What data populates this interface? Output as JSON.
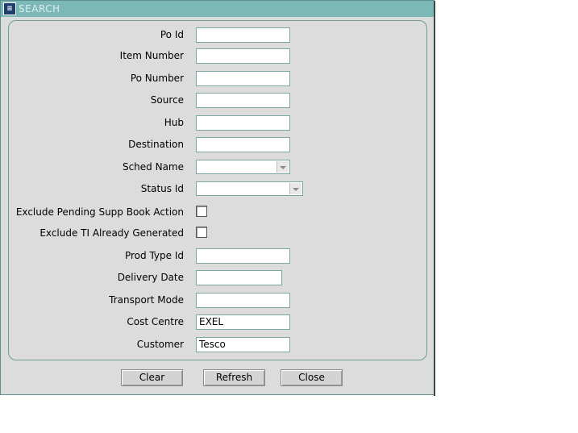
{
  "window": {
    "title": "SEARCH"
  },
  "fields": [
    {
      "label": "Po Id",
      "value": ""
    },
    {
      "label": "Item Number",
      "value": ""
    },
    {
      "label": "Po Number",
      "value": ""
    },
    {
      "label": "Source",
      "value": ""
    },
    {
      "label": "Hub",
      "value": ""
    },
    {
      "label": "Destination",
      "value": ""
    },
    {
      "label": "Sched Name",
      "value": ""
    },
    {
      "label": "Status Id",
      "value": ""
    },
    {
      "label": "Exclude Pending Supp Book Action",
      "checked": false
    },
    {
      "label": "Exclude TI Already Generated",
      "checked": false
    },
    {
      "label": "Prod Type Id",
      "value": ""
    },
    {
      "label": "Delivery Date",
      "value": ""
    },
    {
      "label": "Transport Mode",
      "value": ""
    },
    {
      "label": "Cost Centre",
      "value": "EXEL"
    },
    {
      "label": "Customer",
      "value": "Tesco"
    }
  ],
  "buttons": {
    "clear": "Clear",
    "refresh": "Refresh",
    "close": "Close"
  }
}
